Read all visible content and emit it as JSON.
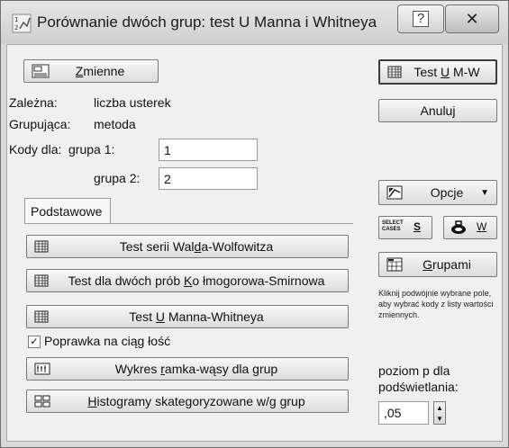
{
  "window": {
    "title": "Porównanie dwóch grup: test U Manna i Whitneya",
    "help_glyph": "?",
    "close_glyph": "✕"
  },
  "variables": {
    "button_label_pre": "",
    "button_label_ul": "Z",
    "button_label_post": "mienne",
    "dependent_label": "Zależna:",
    "dependent_value": "liczba usterek",
    "grouping_label": "Grupująca:",
    "grouping_value": "metoda"
  },
  "codes": {
    "label": "Kody dla:",
    "group1_label": "grupa 1:",
    "group1_value": "1",
    "group2_label": "grupa 2:",
    "group2_value": "2"
  },
  "right_panel": {
    "test_button_pre": "Test ",
    "test_button_ul": "U",
    "test_button_post": " M-W",
    "cancel_label": "Anuluj",
    "options_label": "Opcje",
    "select_cases_icon_text": "SELECT CASES",
    "s_label": "S",
    "w_label": "W",
    "groups_pre": "",
    "groups_ul": "G",
    "groups_post": "rupami",
    "hint": "Kliknij podwójnie wybrane pole, aby wybrać kody z listy wartości zmiennych.",
    "p_level_label_1": "poziom p dla",
    "p_level_label_2": "podświetlania:",
    "p_level_value": ",05"
  },
  "tabs": [
    {
      "label": "Podstawowe"
    }
  ],
  "basic": {
    "wald_pre": "Test serii Wal",
    "wald_ul": "d",
    "wald_post": "a-Wolfowitza",
    "ks_pre": "Test dla dwóch prób ",
    "ks_ul": "K",
    "ks_post": "o łmogorowa-Smirnowa",
    "mw_pre": "Test ",
    "mw_ul": "U",
    "mw_post": " Manna-Whitneya",
    "continuity_label": "Poprawka na ciąg łość",
    "continuity_checked": true,
    "box_pre": "Wykres ",
    "box_ul": "r",
    "box_post": "amka-wąsy dla grup",
    "hist_pre": "",
    "hist_ul": "H",
    "hist_post": "istogramy skategoryzowane w/g grup"
  }
}
